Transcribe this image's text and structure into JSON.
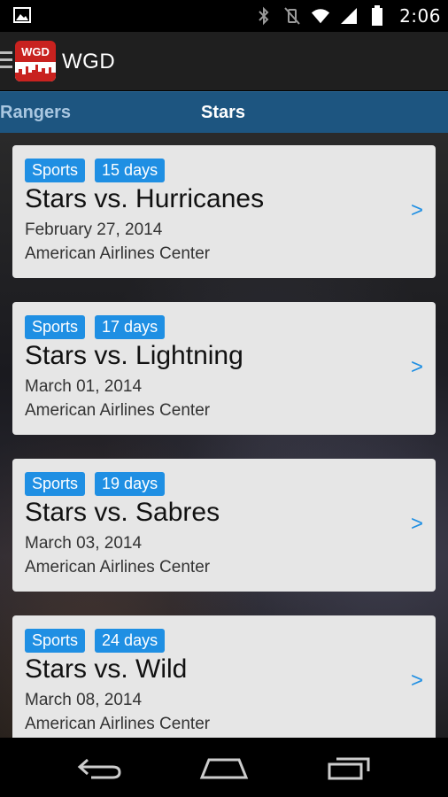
{
  "status_bar": {
    "time": "2:06",
    "icons": [
      "image-icon",
      "bluetooth-icon",
      "vibrate-icon",
      "wifi-icon",
      "signal-icon",
      "battery-icon"
    ]
  },
  "action_bar": {
    "logo_text": "WGD",
    "title": "WGD"
  },
  "tabs": {
    "previous": "Rangers",
    "current": "Stars"
  },
  "events": [
    {
      "category": "Sports",
      "days": "15 days",
      "title": "Stars vs. Hurricanes",
      "date": "February 27, 2014",
      "venue": "American Airlines Center",
      "chevron": ">"
    },
    {
      "category": "Sports",
      "days": "17 days",
      "title": "Stars vs. Lightning",
      "date": "March 01, 2014",
      "venue": "American Airlines Center",
      "chevron": ">"
    },
    {
      "category": "Sports",
      "days": "19 days",
      "title": "Stars vs. Sabres",
      "date": "March 03, 2014",
      "venue": "American Airlines Center",
      "chevron": ">"
    },
    {
      "category": "Sports",
      "days": "24 days",
      "title": "Stars vs. Wild",
      "date": "March 08, 2014",
      "venue": "American Airlines Center",
      "chevron": ">"
    }
  ],
  "colors": {
    "accent": "#1f8fe3",
    "tab_bar": "#1d5580",
    "logo": "#c8221f",
    "card": "#e6e6e6"
  },
  "nav_bar": {
    "icons": [
      "back-icon",
      "home-icon",
      "recents-icon"
    ]
  }
}
